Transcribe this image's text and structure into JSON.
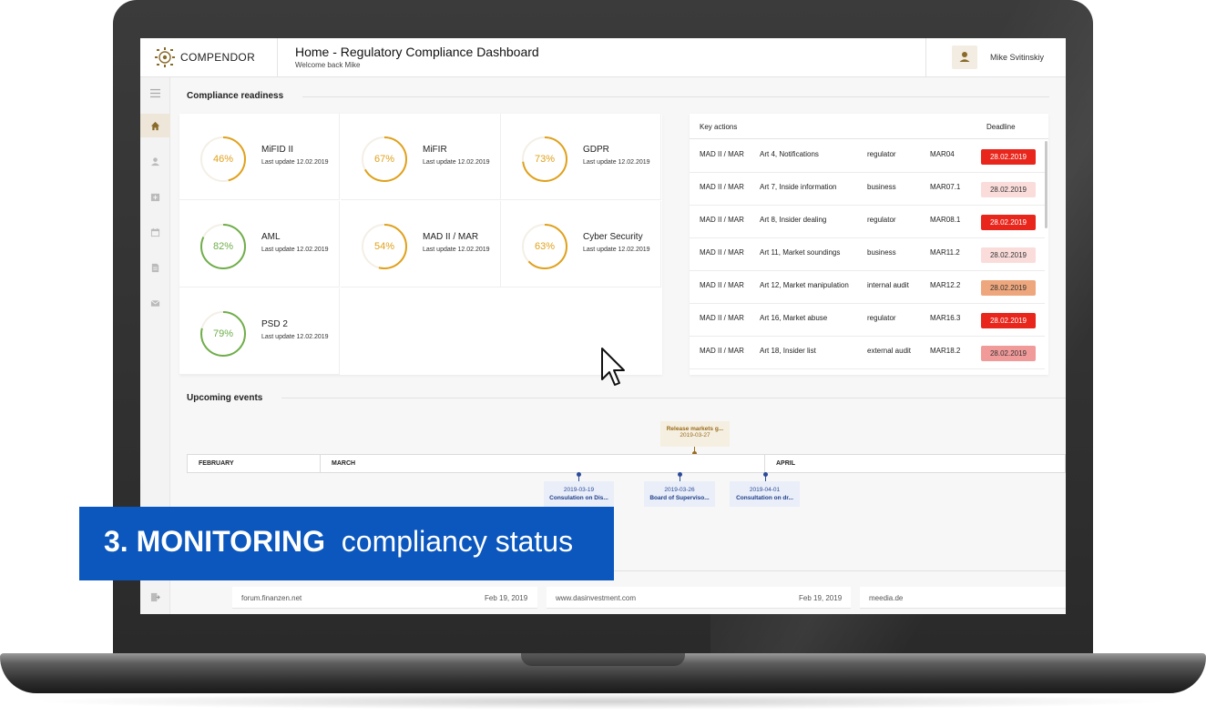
{
  "app": {
    "logo_text": "COMPENDOR",
    "title": "Home - Regulatory Compliance Dashboard",
    "subtitle": "Welcome back Mike",
    "user_name": "Mike Svitinskiy"
  },
  "readiness": {
    "section_title": "Compliance readiness",
    "items": [
      {
        "name": "MiFID II",
        "percent": "46%",
        "value": 46,
        "updated": "Last update 12.02.2019",
        "color": "#e0a11b"
      },
      {
        "name": "MiFIR",
        "percent": "67%",
        "value": 67,
        "updated": "Last update 12.02.2019",
        "color": "#e0a11b"
      },
      {
        "name": "GDPR",
        "percent": "73%",
        "value": 73,
        "updated": "Last update 12.02.2019",
        "color": "#e0a11b"
      },
      {
        "name": "AML",
        "percent": "82%",
        "value": 82,
        "updated": "Last update 12.02.2019",
        "color": "#6fae4a"
      },
      {
        "name": "MAD II / MAR",
        "percent": "54%",
        "value": 54,
        "updated": "Last update 12.02.2019",
        "color": "#e0a11b"
      },
      {
        "name": "Cyber Security",
        "percent": "63%",
        "value": 63,
        "updated": "Last update 12.02.2019",
        "color": "#e0a11b"
      },
      {
        "name": "PSD 2",
        "percent": "79%",
        "value": 79,
        "updated": "Last update 12.02.2019",
        "color": "#6fae4a"
      }
    ]
  },
  "key_actions": {
    "header_label": "Key actions",
    "deadline_label": "Deadline",
    "rows": [
      {
        "reg": "MAD II / MAR",
        "article": "Art 4, Notifications",
        "owner": "regulator",
        "code": "MAR04",
        "deadline": "28.02.2019",
        "badge_bg": "#e8261c",
        "badge_fg": "#ffffff"
      },
      {
        "reg": "MAD II / MAR",
        "article": "Art 7, Inside information",
        "owner": "business",
        "code": "MAR07.1",
        "deadline": "28.02.2019",
        "badge_bg": "#fadcda",
        "badge_fg": "#333333"
      },
      {
        "reg": "MAD II / MAR",
        "article": "Art 8, Insider dealing",
        "owner": "regulator",
        "code": "MAR08.1",
        "deadline": "28.02.2019",
        "badge_bg": "#e8261c",
        "badge_fg": "#ffffff"
      },
      {
        "reg": "MAD II / MAR",
        "article": "Art 11, Market soundings",
        "owner": "business",
        "code": "MAR11.2",
        "deadline": "28.02.2019",
        "badge_bg": "#fadcda",
        "badge_fg": "#333333"
      },
      {
        "reg": "MAD II / MAR",
        "article": "Art 12, Market manipulation",
        "owner": "internal audit",
        "code": "MAR12.2",
        "deadline": "28.02.2019",
        "badge_bg": "#eea77d",
        "badge_fg": "#333333"
      },
      {
        "reg": "MAD II / MAR",
        "article": "Art 16, Market abuse",
        "owner": "regulator",
        "code": "MAR16.3",
        "deadline": "28.02.2019",
        "badge_bg": "#e8261c",
        "badge_fg": "#ffffff"
      },
      {
        "reg": "MAD II / MAR",
        "article": "Art 18, Insider list",
        "owner": "external audit",
        "code": "MAR18.2",
        "deadline": "28.02.2019",
        "badge_bg": "#f19a9a",
        "badge_fg": "#333333"
      }
    ]
  },
  "events": {
    "section_title": "Upcoming events",
    "months": [
      "FEBRUARY",
      "MARCH",
      "APRIL"
    ],
    "top_event": {
      "label": "Release markets g...",
      "date": "2019-03-27"
    },
    "items": [
      {
        "date": "2019-03-19",
        "label": "Consulation on Dis..."
      },
      {
        "date": "2019-03-26",
        "label": "Board of Superviso..."
      },
      {
        "date": "2019-04-01",
        "label": "Consultation on dr..."
      }
    ]
  },
  "news": [
    {
      "source": "forum.finanzen.net",
      "date": "Feb 19, 2019"
    },
    {
      "source": "www.dasinvestment.com",
      "date": "Feb 19, 2019"
    },
    {
      "source": "meedia.de",
      "date": ""
    }
  ],
  "banner": {
    "bold": "3. MONITORING",
    "light": "compliancy status",
    "color": "#0b57bd"
  },
  "nav_icons": [
    "menu-icon",
    "home-icon",
    "user-icon",
    "add-folder-icon",
    "calendar-icon",
    "document-icon",
    "mail-icon",
    "export-icon"
  ]
}
